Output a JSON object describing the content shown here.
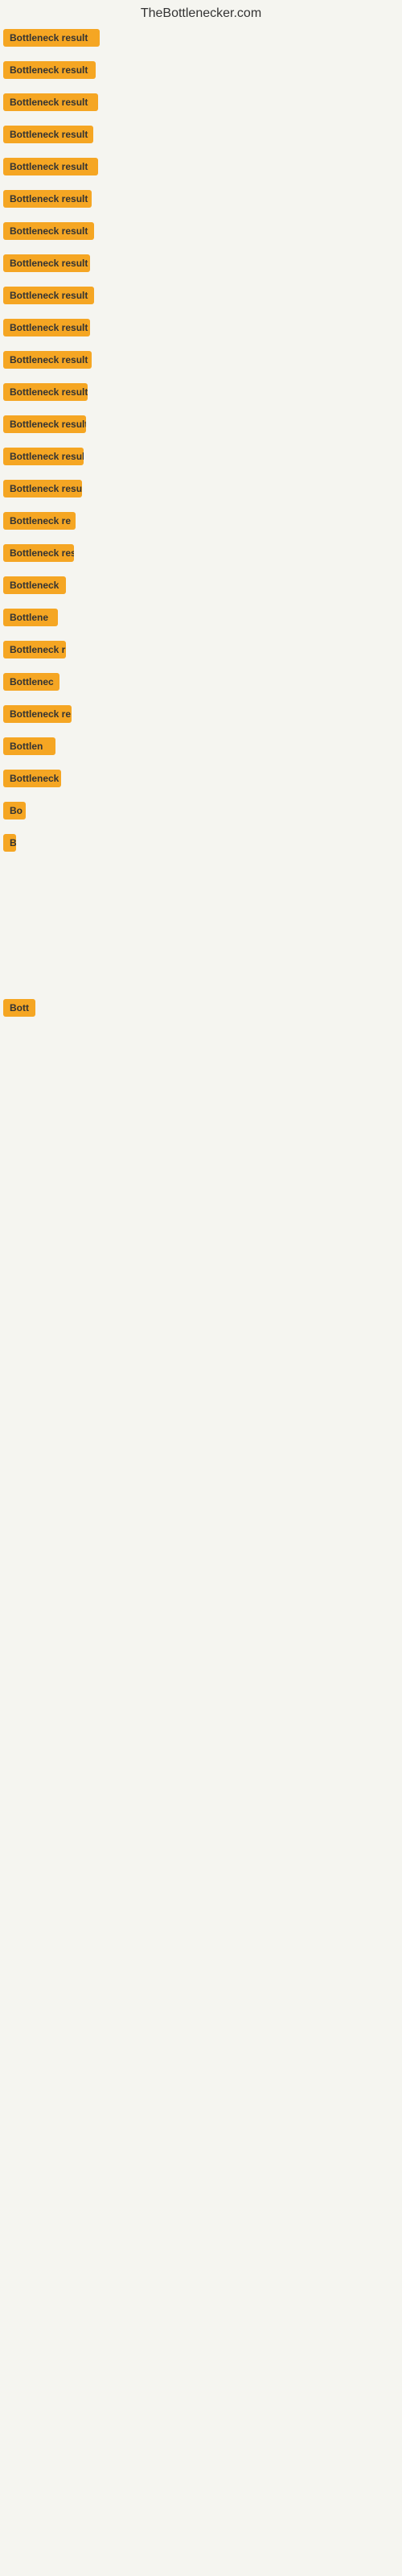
{
  "site": {
    "title": "TheBottlenecker.com"
  },
  "rows": [
    {
      "id": 1,
      "label": "Bottleneck result",
      "class": "row-1"
    },
    {
      "id": 2,
      "label": "Bottleneck result",
      "class": "row-2"
    },
    {
      "id": 3,
      "label": "Bottleneck result",
      "class": "row-3"
    },
    {
      "id": 4,
      "label": "Bottleneck result",
      "class": "row-4"
    },
    {
      "id": 5,
      "label": "Bottleneck result",
      "class": "row-5"
    },
    {
      "id": 6,
      "label": "Bottleneck result",
      "class": "row-6"
    },
    {
      "id": 7,
      "label": "Bottleneck result",
      "class": "row-7"
    },
    {
      "id": 8,
      "label": "Bottleneck result",
      "class": "row-8"
    },
    {
      "id": 9,
      "label": "Bottleneck result",
      "class": "row-9"
    },
    {
      "id": 10,
      "label": "Bottleneck result",
      "class": "row-10"
    },
    {
      "id": 11,
      "label": "Bottleneck result",
      "class": "row-11"
    },
    {
      "id": 12,
      "label": "Bottleneck result",
      "class": "row-12"
    },
    {
      "id": 13,
      "label": "Bottleneck result",
      "class": "row-13"
    },
    {
      "id": 14,
      "label": "Bottleneck result",
      "class": "row-14"
    },
    {
      "id": 15,
      "label": "Bottleneck result",
      "class": "row-15"
    },
    {
      "id": 16,
      "label": "Bottleneck re",
      "class": "row-16"
    },
    {
      "id": 17,
      "label": "Bottleneck resu",
      "class": "row-17"
    },
    {
      "id": 18,
      "label": "Bottleneck",
      "class": "row-18"
    },
    {
      "id": 19,
      "label": "Bottlene",
      "class": "row-19"
    },
    {
      "id": 20,
      "label": "Bottleneck r",
      "class": "row-20"
    },
    {
      "id": 21,
      "label": "Bottlenec",
      "class": "row-21"
    },
    {
      "id": 22,
      "label": "Bottleneck re",
      "class": "row-22"
    },
    {
      "id": 23,
      "label": "Bottlen",
      "class": "row-23"
    },
    {
      "id": 24,
      "label": "Bottleneck",
      "class": "row-24"
    },
    {
      "id": 25,
      "label": "Bo",
      "class": "row-25"
    },
    {
      "id": 26,
      "label": "B",
      "class": "row-26"
    },
    {
      "id": 27,
      "label": "",
      "class": "row-27"
    },
    {
      "id": 28,
      "label": "",
      "class": "row-28"
    },
    {
      "id": 29,
      "label": "",
      "class": "row-29"
    },
    {
      "id": 30,
      "label": "Bott",
      "class": "row-30"
    },
    {
      "id": 31,
      "label": "",
      "class": "row-31"
    },
    {
      "id": 32,
      "label": "",
      "class": "row-32"
    },
    {
      "id": 33,
      "label": "",
      "class": "row-33"
    },
    {
      "id": 34,
      "label": "",
      "class": "row-34"
    },
    {
      "id": 35,
      "label": "",
      "class": "row-35"
    }
  ]
}
